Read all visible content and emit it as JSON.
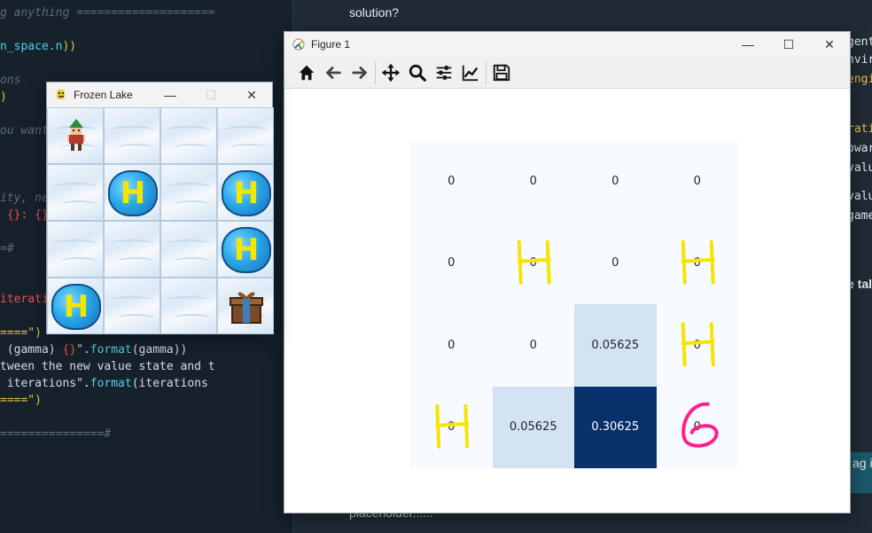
{
  "editor": {
    "lines": [
      {
        "segments": [
          {
            "t": "g anything ====================",
            "c": "c-comment"
          }
        ]
      },
      {
        "segments": [
          {
            "t": "",
            "c": "c-plain"
          }
        ]
      },
      {
        "segments": [
          {
            "t": "n_space.n",
            "c": "c-cyan"
          },
          {
            "t": "))",
            "c": "c-yellow"
          }
        ]
      },
      {
        "segments": [
          {
            "t": "",
            "c": "c-plain"
          }
        ]
      },
      {
        "segments": [
          {
            "t": "ons",
            "c": "c-comment"
          }
        ]
      },
      {
        "segments": [
          {
            "t": ")",
            "c": "c-yellow"
          }
        ]
      },
      {
        "segments": [
          {
            "t": "",
            "c": "c-plain"
          }
        ]
      },
      {
        "segments": [
          {
            "t": "ou want",
            "c": "c-comment"
          }
        ]
      },
      {
        "segments": [
          {
            "t": "",
            "c": "c-plain"
          }
        ]
      },
      {
        "segments": [
          {
            "t": "",
            "c": "c-plain"
          }
        ]
      },
      {
        "segments": [
          {
            "t": "",
            "c": "c-plain"
          }
        ]
      },
      {
        "segments": [
          {
            "t": "ity, ne",
            "c": "c-comment"
          }
        ]
      },
      {
        "segments": [
          {
            "t": " {}: {}",
            "c": "c-red"
          }
        ]
      },
      {
        "segments": [
          {
            "t": "",
            "c": "c-plain"
          }
        ]
      },
      {
        "segments": [
          {
            "t": "=#",
            "c": "c-comment"
          }
        ]
      },
      {
        "segments": [
          {
            "t": "",
            "c": "c-plain"
          }
        ]
      },
      {
        "segments": [
          {
            "t": "",
            "c": "c-plain"
          }
        ]
      },
      {
        "segments": [
          {
            "t": "iterati",
            "c": "c-red"
          }
        ]
      },
      {
        "segments": [
          {
            "t": "",
            "c": "c-plain"
          }
        ]
      },
      {
        "segments": [
          {
            "t": "====\")",
            "c": "c-yellow"
          }
        ]
      },
      {
        "segments": [
          {
            "t": " (gamma) ",
            "c": "c-plain"
          },
          {
            "t": "{}",
            "c": "c-red"
          },
          {
            "t": "\".",
            "c": "c-plain"
          },
          {
            "t": "format",
            "c": "c-cyan"
          },
          {
            "t": "(gamma))",
            "c": "c-plain"
          }
        ]
      },
      {
        "segments": [
          {
            "t": "tween the new value state and t",
            "c": "c-plain"
          }
        ]
      },
      {
        "segments": [
          {
            "t": " iterations\".",
            "c": "c-plain"
          },
          {
            "t": "format",
            "c": "c-cyan"
          },
          {
            "t": "(iterations",
            "c": "c-plain"
          }
        ]
      },
      {
        "segments": [
          {
            "t": "====\")",
            "c": "c-yellow"
          }
        ]
      },
      {
        "segments": [
          {
            "t": "",
            "c": "c-plain"
          }
        ]
      },
      {
        "segments": [
          {
            "t": "===============#",
            "c": "c-comment"
          }
        ]
      }
    ]
  },
  "notes": {
    "top_text": "solution?",
    "bottom_text": "placeholder......",
    "fragments": [
      "gent",
      "nviro",
      "engi",
      "rati",
      "owar",
      "value",
      "valu",
      "game",
      "e tal",
      "ag in"
    ]
  },
  "lake_window": {
    "title": "Frozen Lake",
    "minimize": "—",
    "maximize": "☐",
    "close": "✕",
    "map": [
      "S",
      "F",
      "F",
      "F",
      "F",
      "H",
      "F",
      "H",
      "F",
      "F",
      "F",
      "H",
      "H",
      "F",
      "F",
      "G"
    ]
  },
  "figure_window": {
    "title": "Figure 1",
    "minimize": "—",
    "maximize": "☐",
    "close": "✕",
    "toolbar": [
      "home-icon",
      "back-arrow-icon",
      "forward-arrow-icon",
      "move-icon",
      "zoom-icon",
      "configure-subplots-icon",
      "edit-axis-icon",
      "save-icon"
    ]
  },
  "chart_data": {
    "type": "heatmap",
    "title": "",
    "xlabel": "",
    "ylabel": "",
    "rows": 4,
    "cols": 4,
    "values": [
      [
        0,
        0,
        0,
        0
      ],
      [
        0,
        0,
        0,
        0
      ],
      [
        0,
        0,
        0.05625,
        0
      ],
      [
        0,
        0.05625,
        0.30625,
        0
      ]
    ],
    "labels": [
      [
        "0",
        "0",
        "0",
        "0"
      ],
      [
        "0",
        "0",
        "0",
        "0"
      ],
      [
        "0",
        "0",
        "0.05625",
        "0"
      ],
      [
        "0",
        "0.05625",
        "0.30625",
        "0"
      ]
    ],
    "colormap": "Blues",
    "colorbar": false,
    "annotations_handwritten": [
      {
        "row": 1,
        "col": 1,
        "text": "H",
        "color": "#f5e500"
      },
      {
        "row": 1,
        "col": 3,
        "text": "H",
        "color": "#f5e500"
      },
      {
        "row": 2,
        "col": 3,
        "text": "H",
        "color": "#f5e500"
      },
      {
        "row": 3,
        "col": 0,
        "text": "H",
        "color": "#f5e500"
      },
      {
        "row": 3,
        "col": 3,
        "text": "G",
        "color": "#ff1f8e"
      }
    ]
  }
}
